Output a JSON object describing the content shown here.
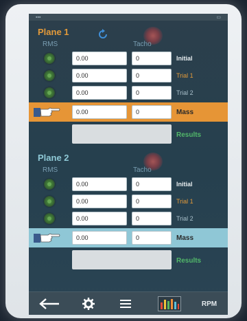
{
  "plane1": {
    "title": "Plane 1",
    "rms_header": "RMS",
    "tacho_header": "Tacho",
    "rows": [
      {
        "rms": "0.00",
        "tacho": "0",
        "label": "Initial"
      },
      {
        "rms": "0.00",
        "tacho": "0",
        "label": "Trial 1"
      },
      {
        "rms": "0.00",
        "tacho": "0",
        "label": "Trial 2"
      }
    ],
    "mass": {
      "rms": "0.00",
      "tacho": "0",
      "label": "Mass"
    },
    "results_label": "Results"
  },
  "plane2": {
    "title": "Plane 2",
    "rms_header": "RMS",
    "tacho_header": "Tacho",
    "rows": [
      {
        "rms": "0.00",
        "tacho": "0",
        "label": "Initial"
      },
      {
        "rms": "0.00",
        "tacho": "0",
        "label": "Trial 1"
      },
      {
        "rms": "0.00",
        "tacho": "0",
        "label": "Trial 2"
      }
    ],
    "mass": {
      "rms": "0.00",
      "tacho": "0",
      "label": "Mass"
    },
    "results_label": "Results"
  },
  "toolbar": {
    "back": "back-arrow-icon",
    "settings": "gear-icon",
    "menu": "menu-icon",
    "chart": "bar-chart-icon",
    "rpm_label": "RPM"
  },
  "colors": {
    "plane1_accent": "#e69536",
    "plane2_accent": "#8fc7d6",
    "results_green": "#52b86a",
    "background": "#2c3f4c"
  }
}
